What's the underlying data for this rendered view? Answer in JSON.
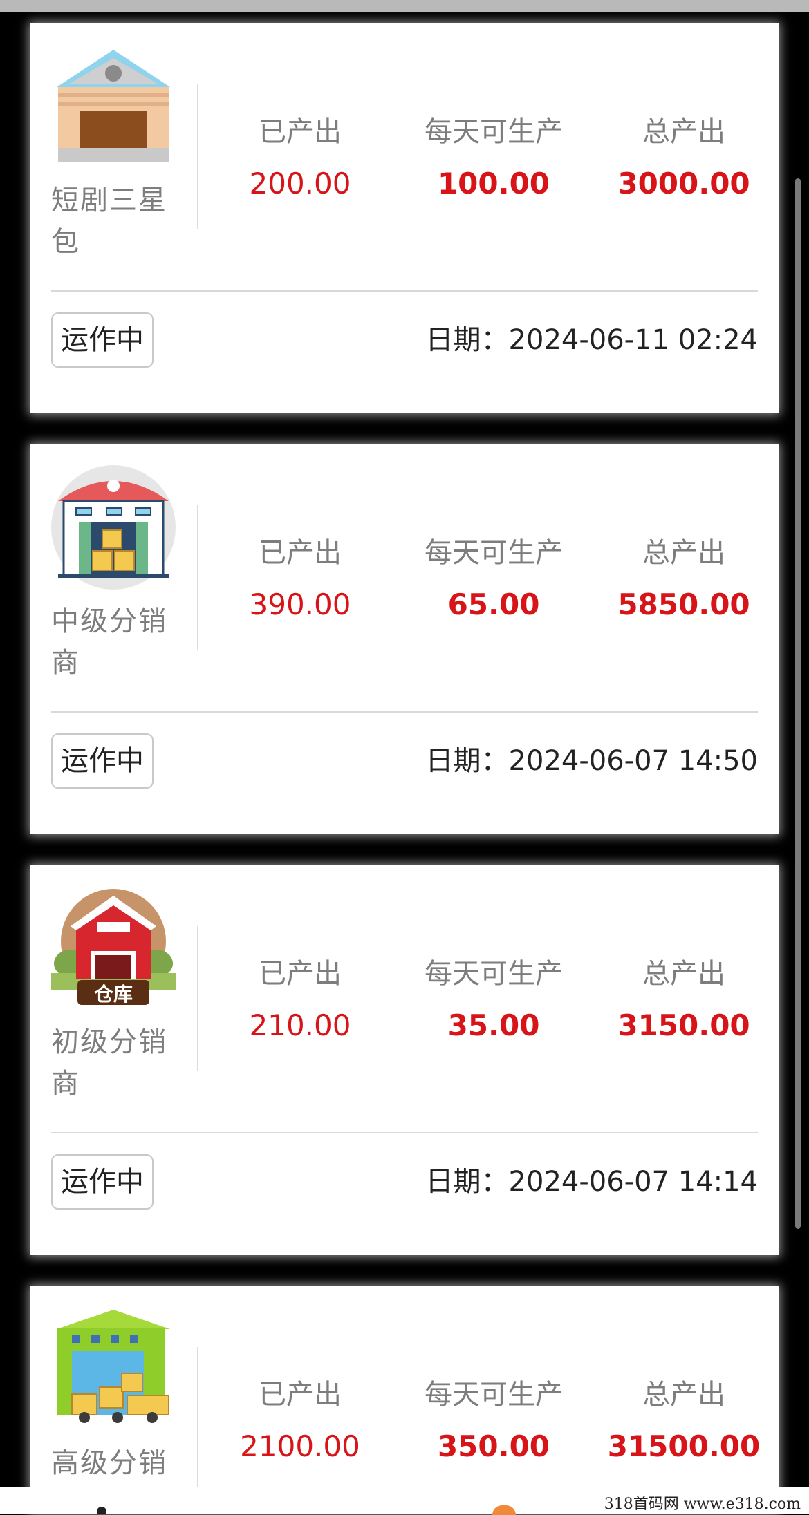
{
  "labels": {
    "produced": "已产出",
    "daily": "每天可生产",
    "total": "总产出"
  },
  "cards": [
    {
      "name": "短剧三星包",
      "icon": "warehouse-gray-icon",
      "produced": "200.00",
      "daily": "100.00",
      "total": "3000.00",
      "status": "运作中",
      "date": "日期：2024-06-11 02:24"
    },
    {
      "name": "中级分销商",
      "icon": "warehouse-red-roof-icon",
      "produced": "390.00",
      "daily": "65.00",
      "total": "5850.00",
      "status": "运作中",
      "date": "日期：2024-06-07 14:50"
    },
    {
      "name": "初级分销商",
      "icon": "red-barn-icon",
      "icon_text": "仓库",
      "produced": "210.00",
      "daily": "35.00",
      "total": "3150.00",
      "status": "运作中",
      "date": "日期：2024-06-07 14:14"
    },
    {
      "name": "高级分销",
      "icon": "green-warehouse-icon",
      "produced": "2100.00",
      "daily": "350.00",
      "total": "31500.00"
    }
  ],
  "watermark": "318首码网   www.e318.com",
  "colors": {
    "value_red": "#d71518",
    "label_gray": "#7d7d7d",
    "background": "#000000"
  }
}
